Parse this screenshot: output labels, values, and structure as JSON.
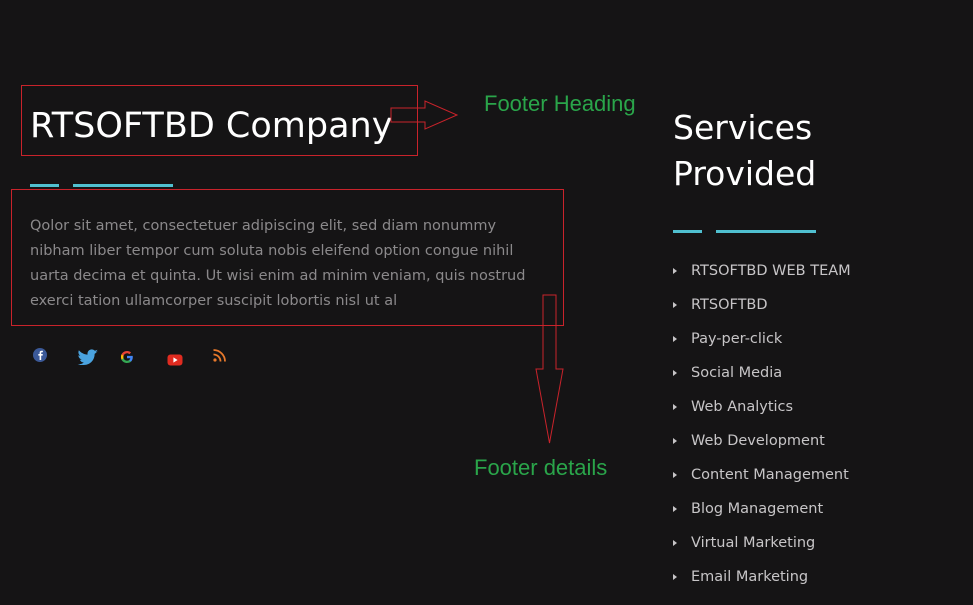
{
  "footer": {
    "company_title": "RTSOFTBD Company",
    "company_description": "Qolor sit amet, consectetuer adipiscing elit, sed diam nonummy nibham liber tempor cum soluta nobis eleifend option congue nihil uarta decima et quinta. Ut wisi enim ad minim veniam, quis nostrud exerci tation ullamcorper suscipit lobortis nisl ut al",
    "social_icons": [
      "facebook-icon",
      "twitter-icon",
      "google-icon",
      "youtube-icon",
      "rss-icon"
    ],
    "services": {
      "title": "Services Provided",
      "items": [
        "RTSOFTBD WEB TEAM",
        "RTSOFTBD",
        "Pay-per-click",
        "Social Media",
        "Web Analytics",
        "Web Development",
        "Content Management",
        "Blog Management",
        "Virtual Marketing",
        "Email Marketing"
      ]
    }
  },
  "annotations": {
    "heading_label": "Footer Heading",
    "details_label": "Footer details"
  },
  "colors": {
    "background": "#151415",
    "accent_line": "#50c0d0",
    "annotation_frame": "#c9232b",
    "annotation_text": "#2aa54a"
  }
}
